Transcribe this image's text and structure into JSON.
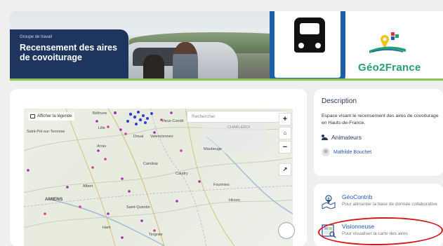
{
  "banner": {
    "group_label": "Groupe de travail",
    "title": "Recensement des aires de covoiturage",
    "logo_text": "Géo2France"
  },
  "map": {
    "legend_button": "Afficher la légende",
    "search_placeholder": "Rechercher",
    "zoom_in": "+",
    "home": "⌂",
    "zoom_out": "−",
    "share": "↗",
    "places": [
      {
        "name": "Béthune"
      },
      {
        "name": "Lille"
      },
      {
        "name": "Vieux-Condé"
      },
      {
        "name": "Saint-Pol-sur-Ternoise"
      },
      {
        "name": "Douai"
      },
      {
        "name": "Valenciennes"
      },
      {
        "name": "Arras"
      },
      {
        "name": "CHARLEROI"
      },
      {
        "name": "Maubeuge"
      },
      {
        "name": "Cambrai"
      },
      {
        "name": "Caudry"
      },
      {
        "name": "Albert"
      },
      {
        "name": "Fourmies"
      },
      {
        "name": "AMIENS"
      },
      {
        "name": "Hirson"
      },
      {
        "name": "Saint-Quentin"
      },
      {
        "name": "Ham"
      },
      {
        "name": "Tergnier"
      }
    ]
  },
  "description": {
    "title": "Description",
    "text": "Espace visant le recensement des aires de covoiturage en Hauts-de-France.",
    "animators_label": "Animateurs",
    "animator_name": "Mathilde Bouchet"
  },
  "tools": [
    {
      "name": "GéoContrib",
      "desc": "Pour alimenter la base de donnée collaborative",
      "icon": "map-pin-icon"
    },
    {
      "name": "Visionneuse",
      "desc": "Pour visualiser la carte des aires",
      "icon": "map-viewer-icon"
    }
  ],
  "colors": {
    "navy": "#1e355e",
    "accent_green": "#8cc44b",
    "link_blue": "#1f57b5",
    "annotation_red": "#d31818"
  }
}
